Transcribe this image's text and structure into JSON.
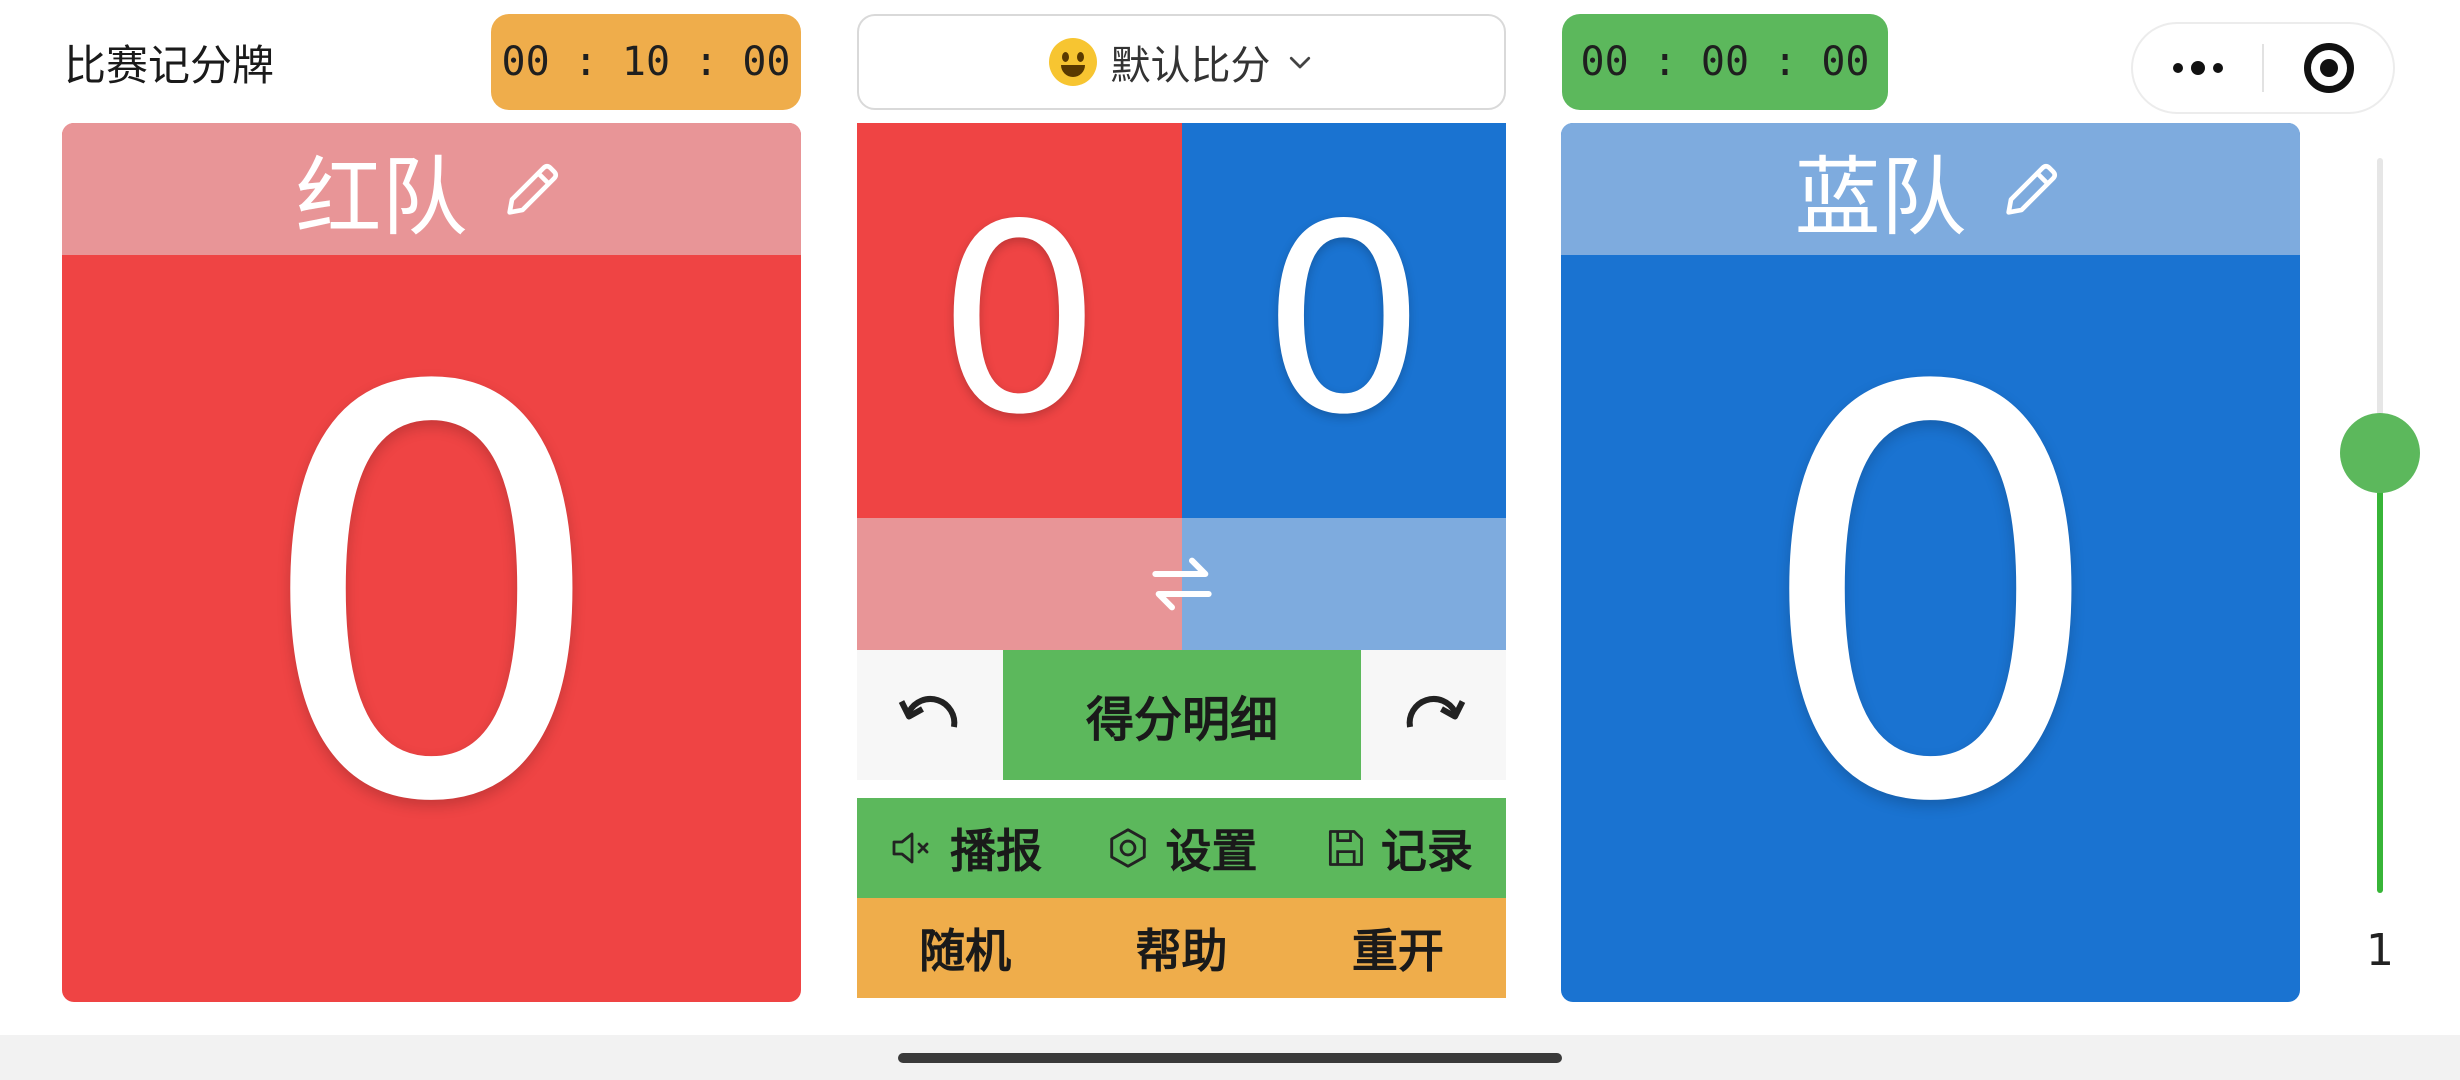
{
  "header": {
    "app_title": "比赛记分牌",
    "red_timer": "00 : 10 : 00",
    "blue_timer": "00 : 00 : 00",
    "mode_select": {
      "icon": "grinning-face-emoji",
      "label": "默认比分"
    },
    "capsule": {
      "more_icon": "more-dots-icon",
      "close_icon": "target-circle-icon"
    }
  },
  "red_team": {
    "name": "红队",
    "score": "0",
    "edit_icon": "pencil-icon",
    "color": "#ef4444",
    "header_color": "#e89597"
  },
  "blue_team": {
    "name": "蓝队",
    "score": "0",
    "edit_icon": "pencil-icon",
    "color": "#1a73d1",
    "header_color": "#7eabde"
  },
  "mini_board": {
    "red_score": "0",
    "blue_score": "0",
    "swap_icon": "swap-arrows-icon",
    "undo_icon": "undo-arrow-icon",
    "redo_icon": "redo-arrow-icon",
    "detail_button": "得分明细"
  },
  "tools": [
    {
      "label": "播报",
      "icon": "speaker-muted-icon"
    },
    {
      "label": "设置",
      "icon": "hexagon-settings-icon"
    },
    {
      "label": "记录",
      "icon": "floppy-save-icon"
    }
  ],
  "actions": [
    {
      "label": "随机"
    },
    {
      "label": "帮助"
    },
    {
      "label": "重开"
    }
  ],
  "slider": {
    "value": "1",
    "accent": "#5cb85c"
  }
}
